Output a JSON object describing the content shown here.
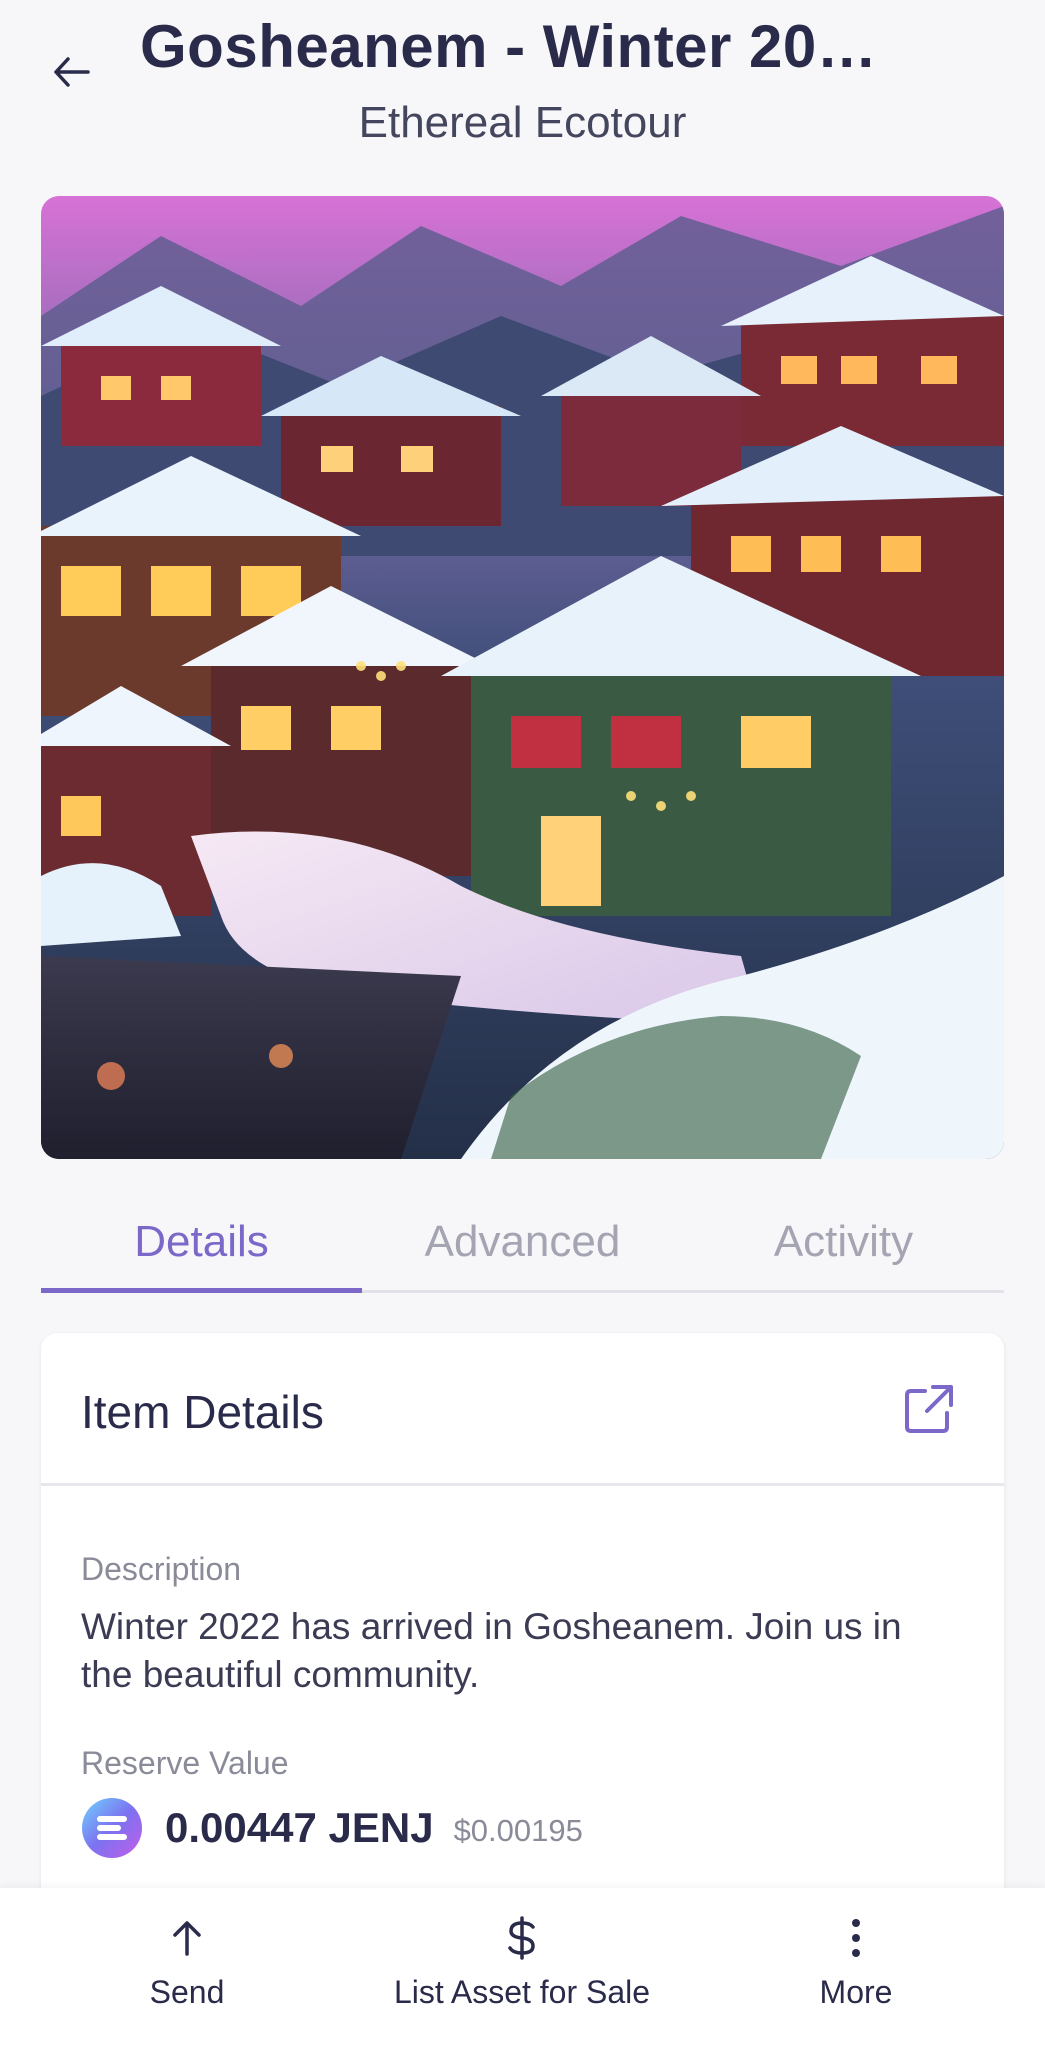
{
  "header": {
    "title": "Gosheanem - Winter 20…",
    "subtitle": "Ethereal Ecotour"
  },
  "hero": {
    "alt": "NFT artwork image",
    "icon": "nft-image"
  },
  "tabs": [
    {
      "label": "Details",
      "active": true
    },
    {
      "label": "Advanced",
      "active": false
    },
    {
      "label": "Activity",
      "active": false
    }
  ],
  "card": {
    "title": "Item Details",
    "description_label": "Description",
    "description": "Winter 2022 has arrived in Gosheanem. Join us in the beautiful community.",
    "reserve_label": "Reserve Value",
    "reserve_value": "0.00447 JENJ",
    "reserve_usd": "$0.00195"
  },
  "bottom_actions": [
    {
      "label": "Send",
      "icon": "arrow-up-icon"
    },
    {
      "label": "List Asset for Sale",
      "icon": "dollar-icon"
    },
    {
      "label": "More",
      "icon": "vertical-dots-icon"
    }
  ],
  "colors": {
    "accent": "#7b68c8",
    "text_dark": "#2a2b4a",
    "text_muted": "#8a8b98",
    "background": "#f7f7f9"
  }
}
